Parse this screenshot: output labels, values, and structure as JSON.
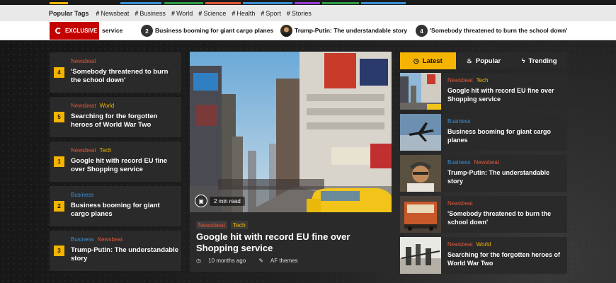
{
  "colors": {
    "accent": "#f4b400",
    "exclusive_red": "#c40000",
    "newsbeat": "#e0583a",
    "business": "#3b8fd6",
    "strip": [
      "#f4b400",
      "#3b8fd6",
      "#2e9e49",
      "#3b8fd6",
      "#f4b400",
      "#e0583a",
      "#3b8fd6",
      "#9b3bd6",
      "#2e9e49",
      "#3b8fd6"
    ]
  },
  "popular_tags": {
    "title": "Popular Tags",
    "tags": [
      "Newsbeat",
      "Business",
      "World",
      "Science",
      "Health",
      "Sport",
      "Stories"
    ]
  },
  "ticker": {
    "exclusive_label": "EXCLUSIVE",
    "leading_text": "service",
    "items": [
      {
        "badge": "2",
        "text": "Business booming for giant cargo planes"
      },
      {
        "badge": "",
        "text": "Trump-Putin: The understandable story"
      },
      {
        "badge": "4",
        "text": "'Somebody threatened to burn the school down'"
      }
    ]
  },
  "left_list": [
    {
      "number": "4",
      "cats": [
        "Newsbeat"
      ],
      "title": "'Somebody threatened to burn the school down'"
    },
    {
      "number": "5",
      "cats": [
        "Newsbeat",
        "World"
      ],
      "title": "Searching for the forgotten heroes of World War Two"
    },
    {
      "number": "1",
      "cats": [
        "Newsbeat",
        "Tech"
      ],
      "title": "Google hit with record EU fine over Shopping service"
    },
    {
      "number": "2",
      "cats": [
        "Business"
      ],
      "title": "Business booming for giant cargo planes"
    },
    {
      "number": "3",
      "cats": [
        "Business",
        "Newsbeat"
      ],
      "title": "Trump-Putin: The understandable story"
    }
  ],
  "featured": {
    "read_time": "2 min read",
    "cats": [
      "Newsbeat",
      "Tech"
    ],
    "title": "Google hit with record EU fine over Shopping service",
    "date": "10 months ago",
    "author": "AF themes"
  },
  "tabs": [
    {
      "label": "Latest",
      "icon": "clock-icon",
      "active": true
    },
    {
      "label": "Popular",
      "icon": "fire-icon",
      "active": false
    },
    {
      "label": "Trending",
      "icon": "bolt-icon",
      "active": false
    }
  ],
  "right_list": [
    {
      "cats": [
        "Newsbeat",
        "Tech"
      ],
      "title": "Google hit with record EU fine over Shopping service",
      "thumb": "city-street"
    },
    {
      "cats": [
        "Business"
      ],
      "title": "Business booming for giant cargo planes",
      "thumb": "cargo-plane"
    },
    {
      "cats": [
        "Business",
        "Newsbeat"
      ],
      "title": "Trump-Putin: The understandable story",
      "thumb": "portrait"
    },
    {
      "cats": [
        "Newsbeat"
      ],
      "title": "'Somebody threatened to burn the school down'",
      "thumb": "bus"
    },
    {
      "cats": [
        "Newsbeat",
        "World"
      ],
      "title": "Searching for the forgotten heroes of World War Two",
      "thumb": "soldiers"
    }
  ]
}
